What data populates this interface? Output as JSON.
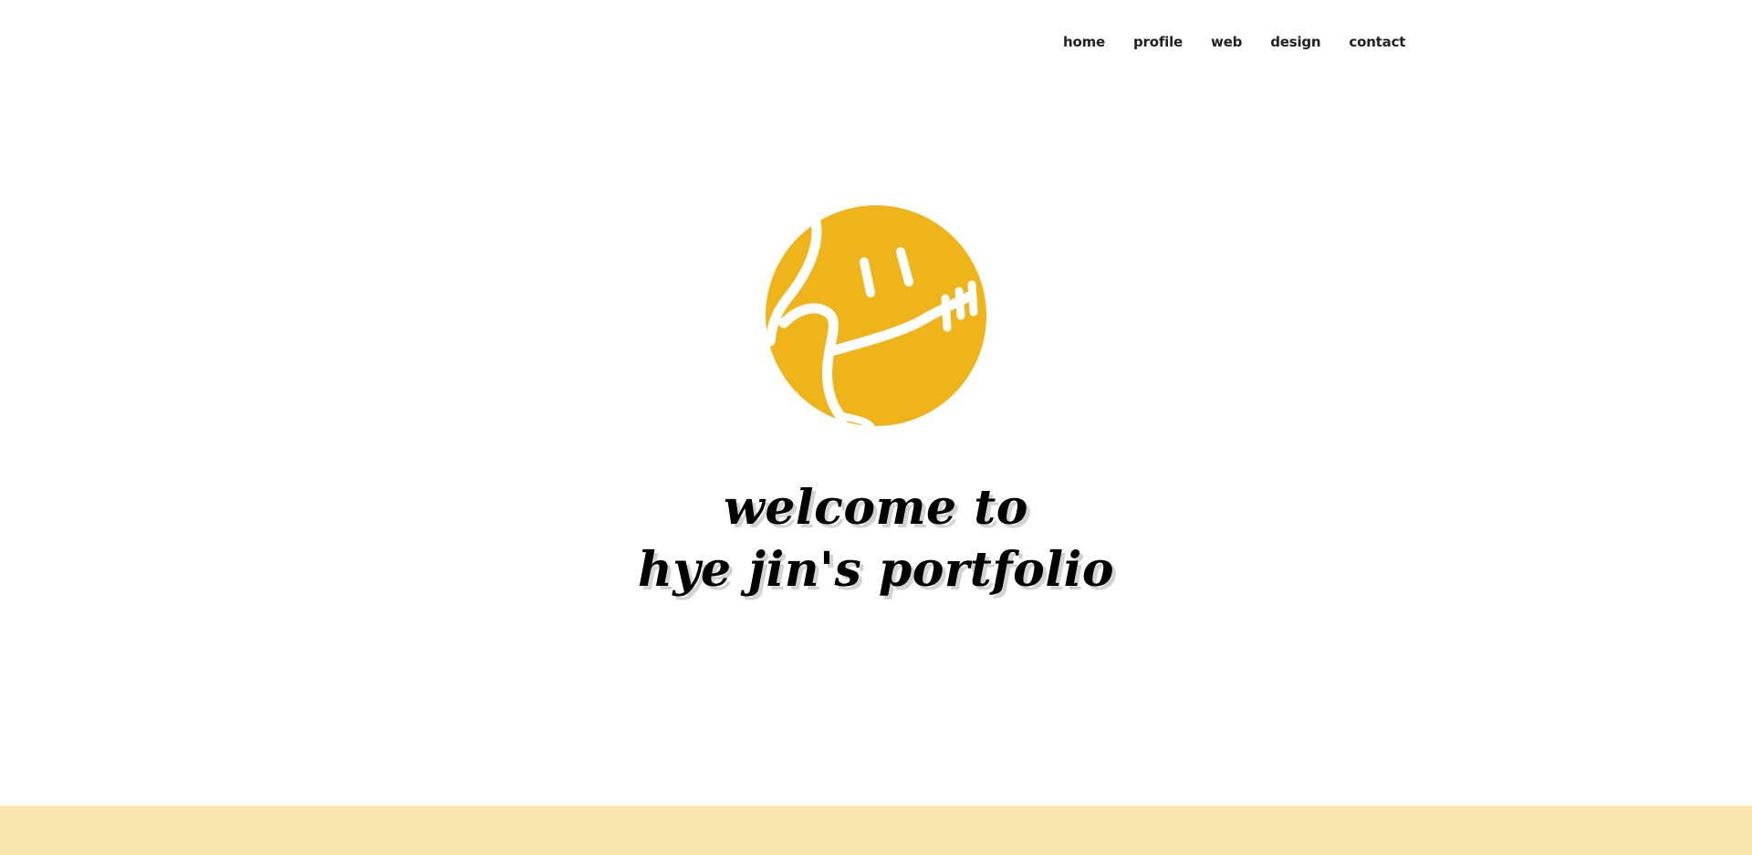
{
  "nav": {
    "items": [
      {
        "label": "home"
      },
      {
        "label": "profile"
      },
      {
        "label": "web"
      },
      {
        "label": "design"
      },
      {
        "label": "contact"
      }
    ]
  },
  "logo": {
    "icon": "smiley-logo-icon",
    "color": "#f0b41b"
  },
  "hero": {
    "line1": "welcome to",
    "line2": "hye jin's portfolio"
  },
  "footer": {
    "color": "#f9e5ae"
  }
}
